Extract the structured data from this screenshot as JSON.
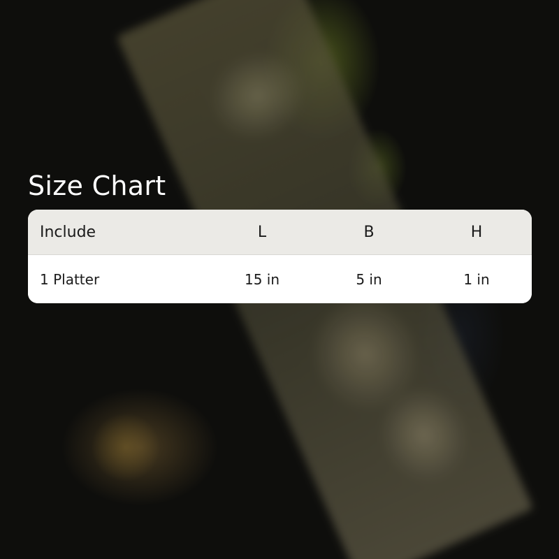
{
  "title": "Size Chart",
  "table": {
    "headers": [
      "Include",
      "L",
      "B",
      "H"
    ],
    "rows": [
      [
        "1 Platter",
        "15 in",
        "5 in",
        "1 in"
      ]
    ]
  },
  "colors": {
    "header_bg": "#ebeae6",
    "body_bg": "#ffffff",
    "title_text": "#ffffff",
    "cell_text": "#1a1a1a"
  }
}
